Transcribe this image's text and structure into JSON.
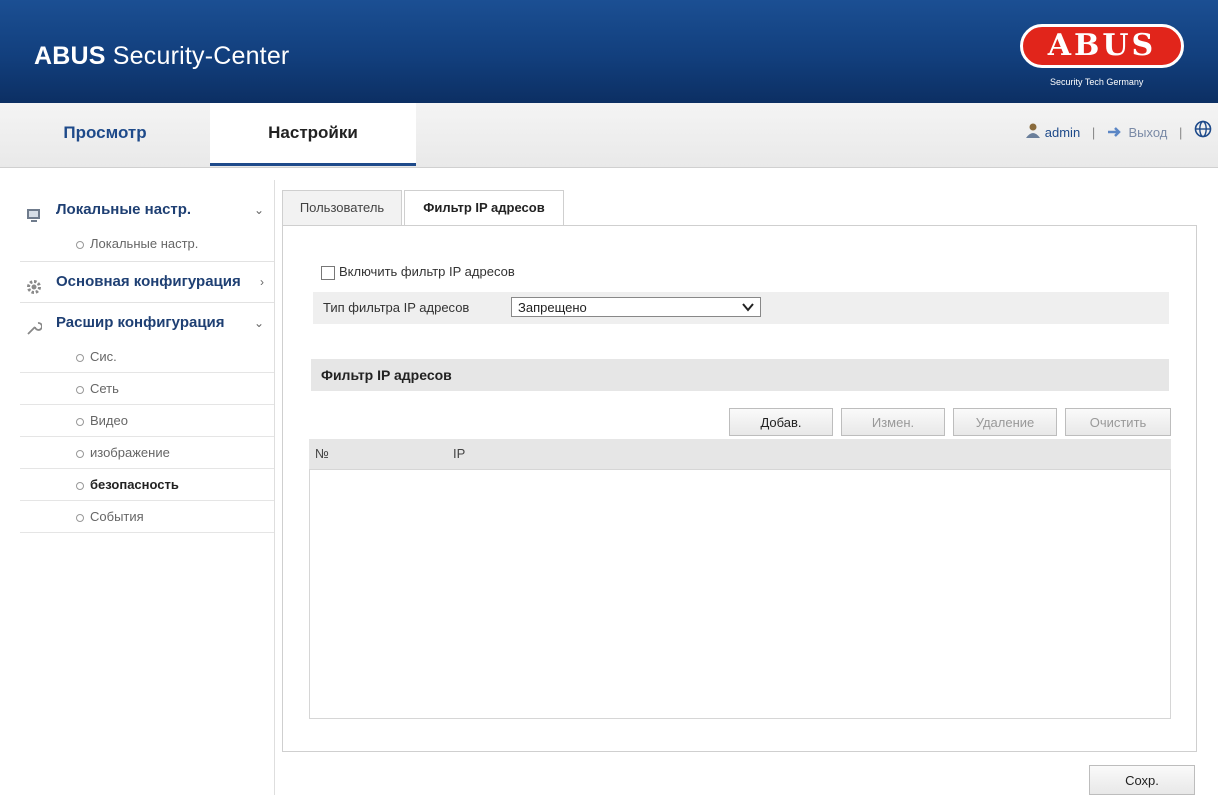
{
  "header": {
    "title_brand": "ABUS",
    "title_rest": " Security-Center",
    "logo_text": "ABUS",
    "logo_sub": "Security Tech Germany"
  },
  "topnav": {
    "tabs": [
      {
        "label": "Просмотр",
        "active": false
      },
      {
        "label": "Настройки",
        "active": true
      }
    ],
    "user": "admin",
    "logout": "Выход",
    "separator": "|"
  },
  "sidebar": {
    "groups": [
      {
        "label": "Локальные настр.",
        "icon": "local-settings-icon",
        "chevron": "⌄",
        "items": [
          {
            "label": "Локальные настр.",
            "active": false
          }
        ]
      },
      {
        "label": "Основная конфигурация",
        "icon": "gear-icon",
        "chevron": "›",
        "items": []
      },
      {
        "label": "Расшир конфигурация",
        "icon": "wrench-icon",
        "chevron": "⌄",
        "items": [
          {
            "label": "Сис.",
            "active": false
          },
          {
            "label": "Сеть",
            "active": false
          },
          {
            "label": "Видео",
            "active": false
          },
          {
            "label": "изображение",
            "active": false
          },
          {
            "label": "безопасность",
            "active": true
          },
          {
            "label": "События",
            "active": false
          }
        ]
      }
    ]
  },
  "content": {
    "tabs": [
      {
        "label": "Пользователь",
        "active": false
      },
      {
        "label": "Фильтр IP адресов",
        "active": true
      }
    ],
    "enable_label": "Включить фильтр IP адресов",
    "enable_checked": false,
    "type_label": "Тип фильтра IP адресов",
    "type_value": "Запрещено",
    "section_title": "Фильтр IP адресов",
    "buttons": {
      "add": "Добав.",
      "edit": "Измен.",
      "delete": "Удаление",
      "clear": "Очистить"
    },
    "table_headers": [
      "№",
      "IP"
    ],
    "table_rows": [],
    "save": "Сохр."
  },
  "colors": {
    "header_bg": "#123f7d",
    "nav_text": "#1e4a8a",
    "logo_red": "#e1251b"
  }
}
